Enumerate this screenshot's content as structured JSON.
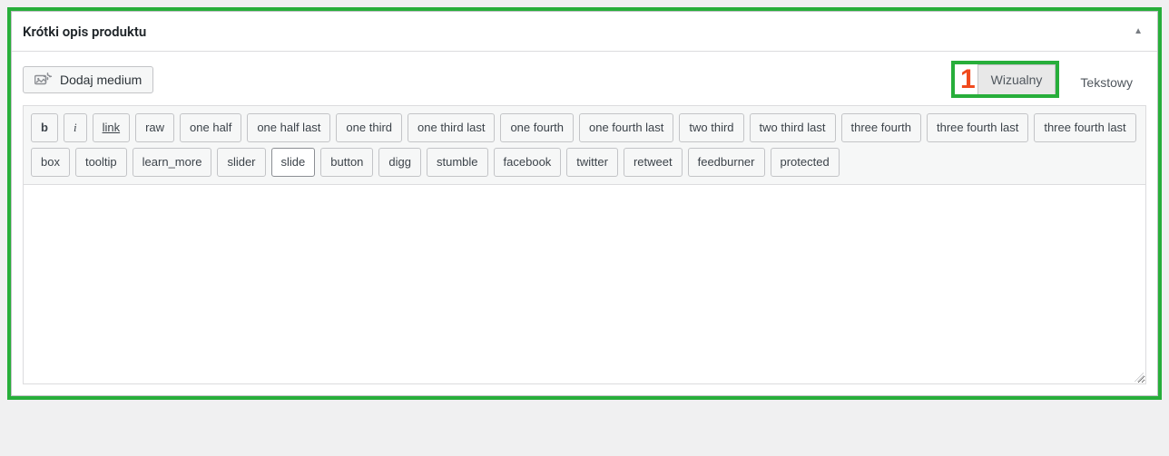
{
  "panel": {
    "title": "Krótki opis produktu"
  },
  "media_button": {
    "label": "Dodaj medium"
  },
  "marker": "1",
  "tabs": {
    "visual": "Wizualny",
    "text": "Tekstowy"
  },
  "quicktags": [
    {
      "id": "b",
      "label": "b",
      "style": "bold"
    },
    {
      "id": "i",
      "label": "i",
      "style": "italic"
    },
    {
      "id": "link",
      "label": "link",
      "style": "underline"
    },
    {
      "id": "raw",
      "label": "raw"
    },
    {
      "id": "onehalf",
      "label": "one half"
    },
    {
      "id": "onehalflast",
      "label": "one half last"
    },
    {
      "id": "onethird",
      "label": "one third"
    },
    {
      "id": "onethirdlast",
      "label": "one third last"
    },
    {
      "id": "onefourth",
      "label": "one fourth"
    },
    {
      "id": "onefourthlast",
      "label": "one fourth last"
    },
    {
      "id": "twothird",
      "label": "two third"
    },
    {
      "id": "twothirdlast",
      "label": "two third last"
    },
    {
      "id": "threefourth",
      "label": "three fourth"
    },
    {
      "id": "threefourthlast",
      "label": "three fourth last"
    },
    {
      "id": "threefourthlast2",
      "label": "three fourth last"
    },
    {
      "id": "box",
      "label": "box"
    },
    {
      "id": "tooltip",
      "label": "tooltip"
    },
    {
      "id": "learnmore",
      "label": "learn_more"
    },
    {
      "id": "slider",
      "label": "slider"
    },
    {
      "id": "slide",
      "label": "slide",
      "pressed": true
    },
    {
      "id": "button",
      "label": "button"
    },
    {
      "id": "digg",
      "label": "digg"
    },
    {
      "id": "stumble",
      "label": "stumble"
    },
    {
      "id": "facebook",
      "label": "facebook"
    },
    {
      "id": "twitter",
      "label": "twitter"
    },
    {
      "id": "retweet",
      "label": "retweet"
    },
    {
      "id": "feedburner",
      "label": "feedburner"
    },
    {
      "id": "protected",
      "label": "protected"
    }
  ],
  "editor": {
    "content": ""
  }
}
